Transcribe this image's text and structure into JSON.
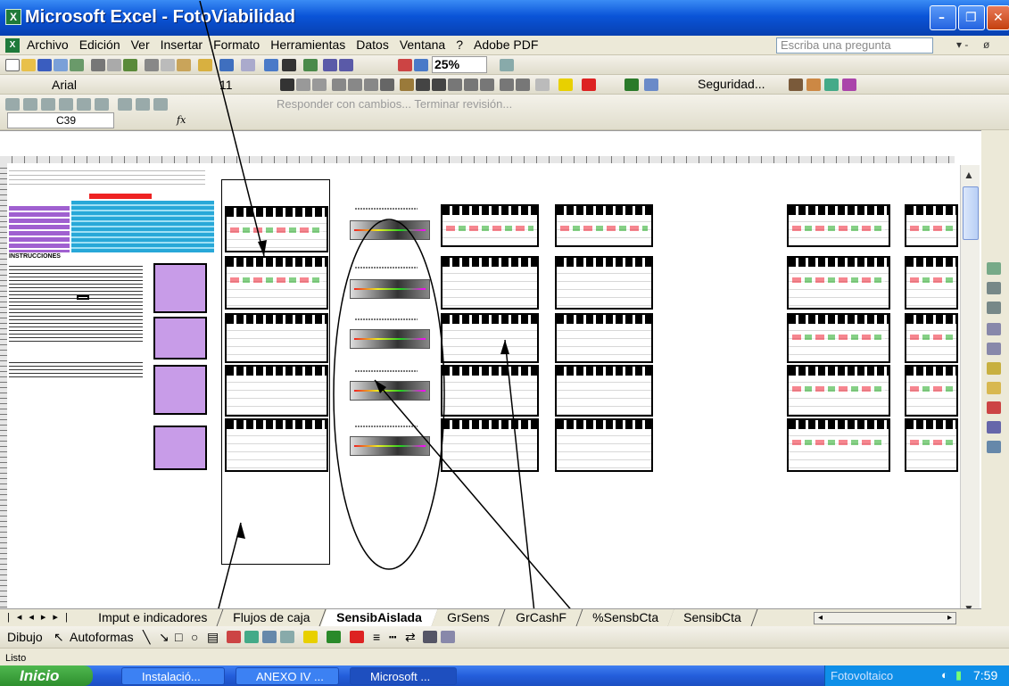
{
  "window": {
    "app_title": "Microsoft Excel - FotoViabilidad",
    "min_glyph": "–",
    "max_glyph": "❐",
    "close_glyph": "✕"
  },
  "menu": {
    "items": [
      "Archivo",
      "Edición",
      "Ver",
      "Insertar",
      "Formato",
      "Herramientas",
      "Datos",
      "Ventana",
      "?",
      "Adobe PDF"
    ],
    "ask_placeholder": "Escriba una pregunta"
  },
  "toolbar": {
    "zoom": "25%",
    "font_name": "Arial",
    "font_size": "11",
    "security_label": "Seguridad...",
    "review_text": "Responder con cambios... Terminar revisión..."
  },
  "formula_bar": {
    "cell_ref": "C39",
    "fx_label": "fx"
  },
  "sheet": {
    "left_panel_label": "INSTRUCCIONES"
  },
  "tabs": {
    "sheets": [
      "Imput e indicadores",
      "Flujos de caja",
      "SensibAislada",
      "GrSens",
      "GrCashF",
      "%SensbCta",
      "SensibCta"
    ],
    "active_index": 2
  },
  "draw_toolbar": {
    "draw_label": "Dibujo",
    "autoshapes_label": "Autoformas"
  },
  "status_bar": {
    "text": "Listo"
  },
  "taskbar": {
    "start_label": "Inicio",
    "tasks": [
      "Instalació...",
      "ANEXO IV ...",
      "Microsoft ..."
    ],
    "tray_label": "Fotovoltaico",
    "time": "7:59"
  },
  "colors": {
    "titlebar": "#0a54d8",
    "lavender_box": "#c89ce8",
    "taskbar": "#245edb",
    "start_button": "#2e8f2e"
  }
}
